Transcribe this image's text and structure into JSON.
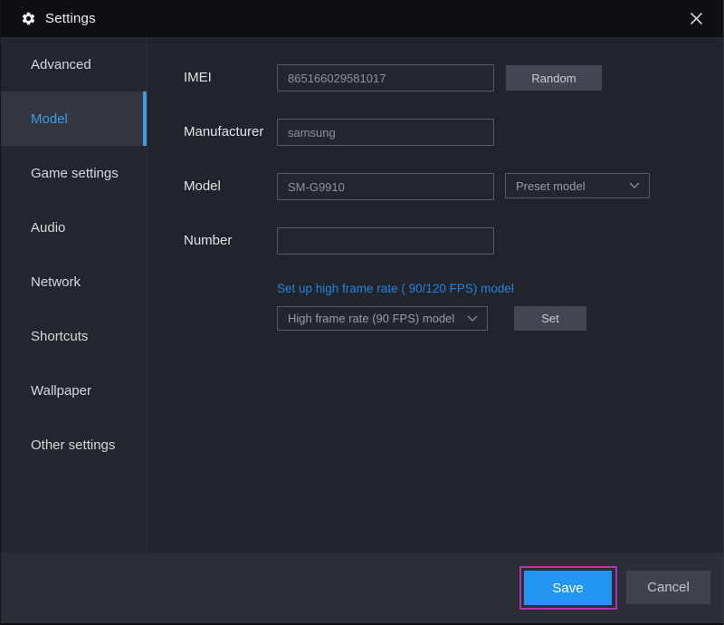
{
  "titlebar": {
    "title": "Settings"
  },
  "sidebar": {
    "items": [
      {
        "label": "Advanced",
        "selected": false
      },
      {
        "label": "Model",
        "selected": true
      },
      {
        "label": "Game settings",
        "selected": false
      },
      {
        "label": "Audio",
        "selected": false
      },
      {
        "label": "Network",
        "selected": false
      },
      {
        "label": "Shortcuts",
        "selected": false
      },
      {
        "label": "Wallpaper",
        "selected": false
      },
      {
        "label": "Other settings",
        "selected": false
      }
    ]
  },
  "form": {
    "imei": {
      "label": "IMEI",
      "value": "865166029581017",
      "random_label": "Random"
    },
    "manufacturer": {
      "label": "Manufacturer",
      "value": "samsung"
    },
    "model": {
      "label": "Model",
      "value": "SM-G9910",
      "preset_label": "Preset model"
    },
    "number": {
      "label": "Number",
      "value": ""
    },
    "high_frame_rate": {
      "link_label": "Set up high frame rate ( 90/120 FPS) model",
      "dropdown_value": "High frame rate (90 FPS) model",
      "set_label": "Set"
    }
  },
  "footer": {
    "save_label": "Save",
    "cancel_label": "Cancel"
  },
  "colors": {
    "accent_blue": "#2196f3",
    "selected_item_blue": "#3f9ce6",
    "link_blue": "#1f85e0",
    "highlight_magenta": "#b234b4",
    "titlebar_bg": "#0d0f14",
    "panel_bg": "#22242b",
    "bottombar_bg": "#2b2e37"
  }
}
